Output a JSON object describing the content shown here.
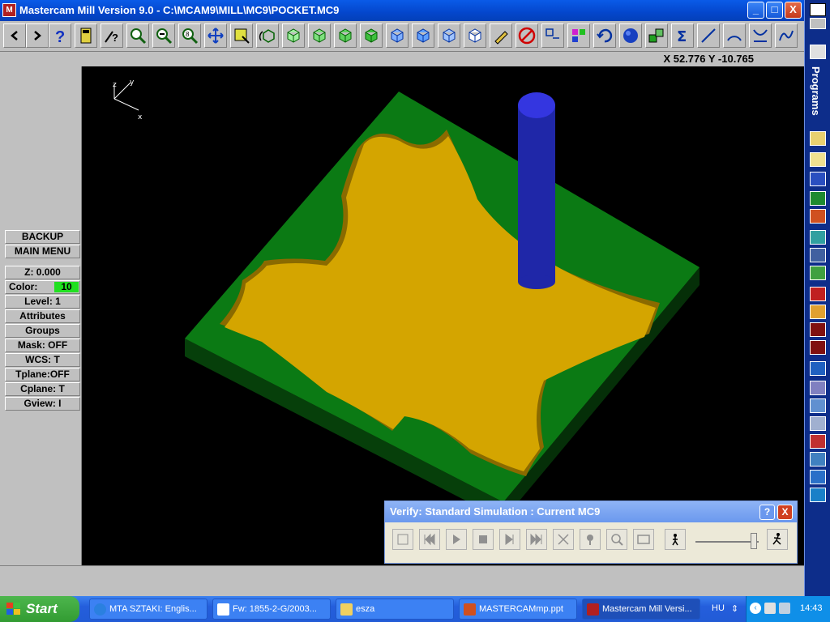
{
  "window": {
    "title": "Mastercam Mill Version 9.0 - C:\\MCAM9\\MILL\\MC9\\POCKET.MC9",
    "app_icon": "mastercam-app-icon",
    "minimize": "_",
    "maximize": "□",
    "close": "X"
  },
  "programs_bar": {
    "label": "Programs"
  },
  "coords": {
    "text": "X 52.776  Y -10.765"
  },
  "axis": {
    "x": "x",
    "y": "y",
    "z": "z"
  },
  "menu": {
    "backup": "BACKUP",
    "main_menu": "MAIN MENU",
    "z": "Z:  0.000",
    "color_label": "Color:",
    "color_value": "10",
    "level": "Level:  1",
    "attributes": "Attributes",
    "groups": "Groups",
    "mask": "Mask:  OFF",
    "wcs": "WCS:   T",
    "tplane": "Tplane:OFF",
    "cplane": "Cplane:  T",
    "gview": "Gview:   I"
  },
  "verify": {
    "title": "Verify: Standard Simulation : Current MC9",
    "help": "?",
    "close": "X"
  },
  "taskbar": {
    "start": "Start",
    "tasks": [
      {
        "label": "MTA SZTAKI: Englis..."
      },
      {
        "label": "Fw: 1855-2-G/2003..."
      },
      {
        "label": "esza"
      },
      {
        "label": "MASTERCAMmp.ppt"
      },
      {
        "label": "Mastercam Mill Versi..."
      }
    ],
    "lang": "HU",
    "time": "14:43"
  },
  "colors": {
    "stock_green": "#0b7a14",
    "pocket_floor": "#d4a500",
    "tool_blue": "#1f27a8"
  }
}
